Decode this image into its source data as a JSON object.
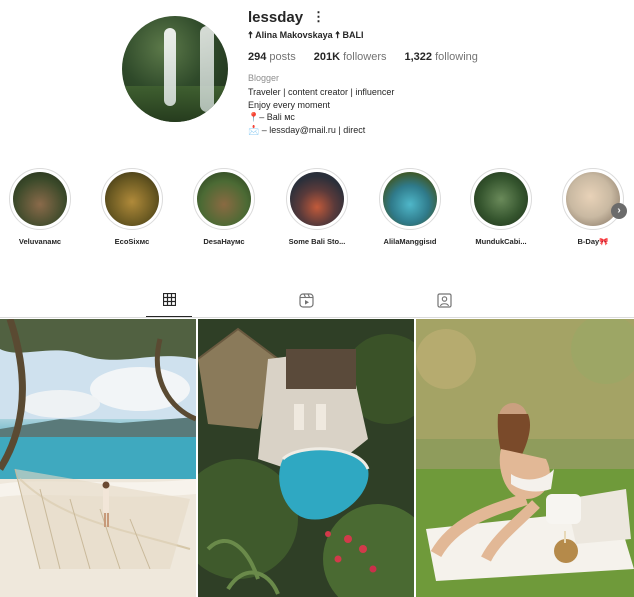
{
  "profile": {
    "username": "lessday",
    "full_name": "☨ Alina Makovskaya ☨ BALI",
    "stats": {
      "posts_count": "294",
      "posts_label": "posts",
      "followers_count": "201K",
      "followers_label": "followers",
      "following_count": "1,322",
      "following_label": "following"
    },
    "category": "Blogger",
    "bio_lines": [
      "Traveler | content creator | influencer",
      "Enjoy every moment",
      "📍– Bali мс",
      "📩 – lessday@mail.ru | direct"
    ]
  },
  "highlights": [
    {
      "label": "Veluvanaмс",
      "color": "#3c4a2a"
    },
    {
      "label": "EcoSixмс",
      "color": "#6b5a22"
    },
    {
      "label": "DesaНаумс",
      "color": "#4b6a34"
    },
    {
      "label": "Some Bali Sto...",
      "color": "#2a2f3a"
    },
    {
      "label": "AlilaManggisιd",
      "color": "#2f7a8a"
    },
    {
      "label": "MundukCabi...",
      "color": "#35552e"
    },
    {
      "label": "B-Day🎀",
      "color": "#c9b9a2"
    }
  ],
  "tabs": [
    {
      "name": "posts-grid",
      "icon": "grid-icon",
      "active": true
    },
    {
      "name": "reels",
      "icon": "reels-icon",
      "active": false
    },
    {
      "name": "tagged",
      "icon": "tagged-icon",
      "active": false
    }
  ],
  "posts": [
    {
      "subject": "beach-hammock",
      "icon": "photo"
    },
    {
      "subject": "villa-pool-aerial",
      "icon": "photo"
    },
    {
      "subject": "woman-picnic-grass",
      "icon": "photo"
    }
  ]
}
